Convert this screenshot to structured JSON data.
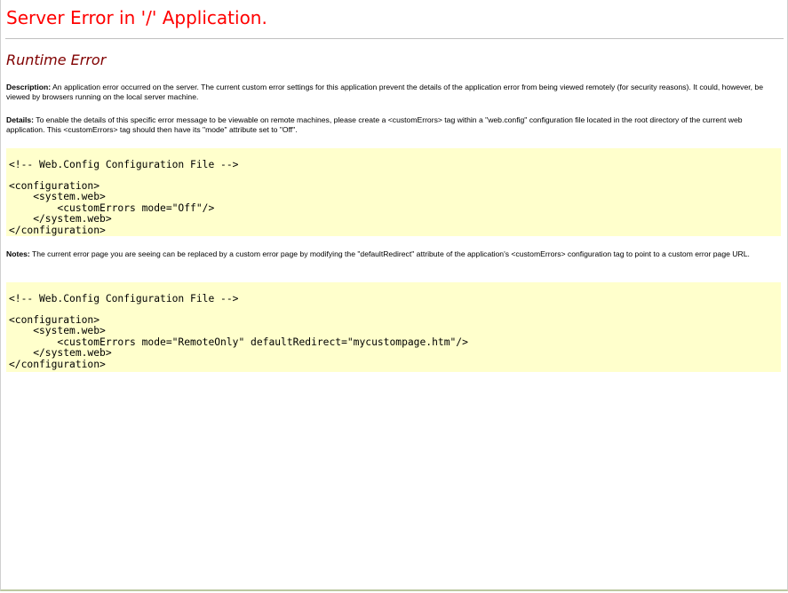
{
  "title": "Server Error in '/' Application.",
  "subtitle": "Runtime Error",
  "description": {
    "label": "Description:",
    "text": " An application error occurred on the server. The current custom error settings for this application prevent the details of the application error from being viewed remotely (for security reasons). It could, however, be viewed by browsers running on the local server machine."
  },
  "details": {
    "label": "Details:",
    "text": " To enable the details of this specific error message to be viewable on remote machines, please create a <customErrors> tag within a \"web.config\" configuration file located in the root directory of the current web application. This <customErrors> tag should then have its \"mode\" attribute set to \"Off\"."
  },
  "code_block_1": {
    "comment": "<!-- Web.Config Configuration File -->",
    "body": "<configuration>\n    <system.web>\n        <customErrors mode=\"Off\"/>\n    </system.web>\n</configuration>"
  },
  "notes": {
    "label": "Notes:",
    "text": " The current error page you are seeing can be replaced by a custom error page by modifying the \"defaultRedirect\" attribute of the application's <customErrors> configuration tag to point to a custom error page URL."
  },
  "code_block_2": {
    "comment": "<!-- Web.Config Configuration File -->",
    "body": "<configuration>\n    <system.web>\n        <customErrors mode=\"RemoteOnly\" defaultRedirect=\"mycustompage.htm\"/>\n    </system.web>\n</configuration>"
  }
}
